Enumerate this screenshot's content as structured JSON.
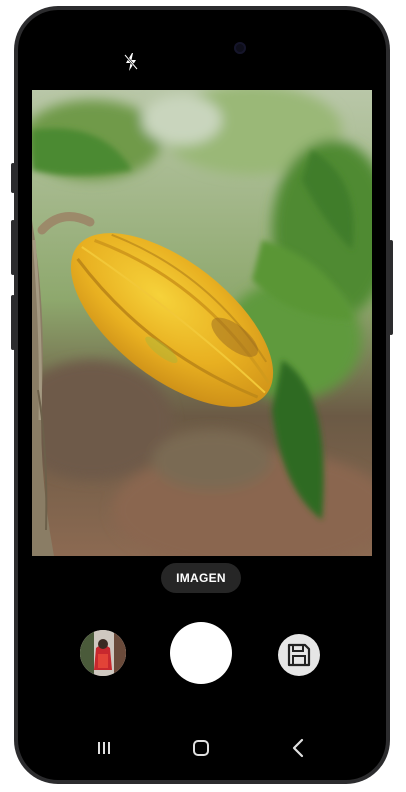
{
  "camera": {
    "mode_label": "IMAGEN"
  },
  "icons": {
    "flash": "flash-auto-icon",
    "gallery": "gallery-thumbnail",
    "shutter": "shutter-button",
    "save": "save-icon",
    "recents": "recents-icon",
    "home": "home-icon",
    "back": "back-icon"
  },
  "colors": {
    "pod_yellow": "#e8b021",
    "leaf_green": "#3f7d2a",
    "ui_black": "#000000",
    "pill_bg": "#262626"
  }
}
